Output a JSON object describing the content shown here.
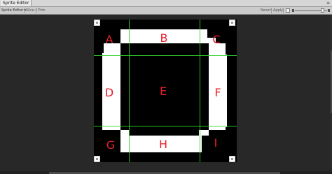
{
  "window": {
    "tab_title": "Sprite Editor",
    "menu_glyph": "≡"
  },
  "toolbar": {
    "sprite_dropdown": "Sprite Editor ▾",
    "slice_dropdown": "Slice ▾",
    "trim_label": "Trim",
    "revert_label": "Revert",
    "apply_label": "Apply",
    "zoom_level": 0.9
  },
  "colors": {
    "border_guide": "#2fd42f",
    "label": "#e8202a",
    "sprite_fill": "#000000",
    "sprite_frame": "#ffffff",
    "canvas_bg": "#282828"
  },
  "slice_regions": {
    "A": "A",
    "B": "B",
    "C": "C",
    "D": "D",
    "E": "E",
    "F": "F",
    "G": "G",
    "H": "H",
    "I": "I"
  }
}
